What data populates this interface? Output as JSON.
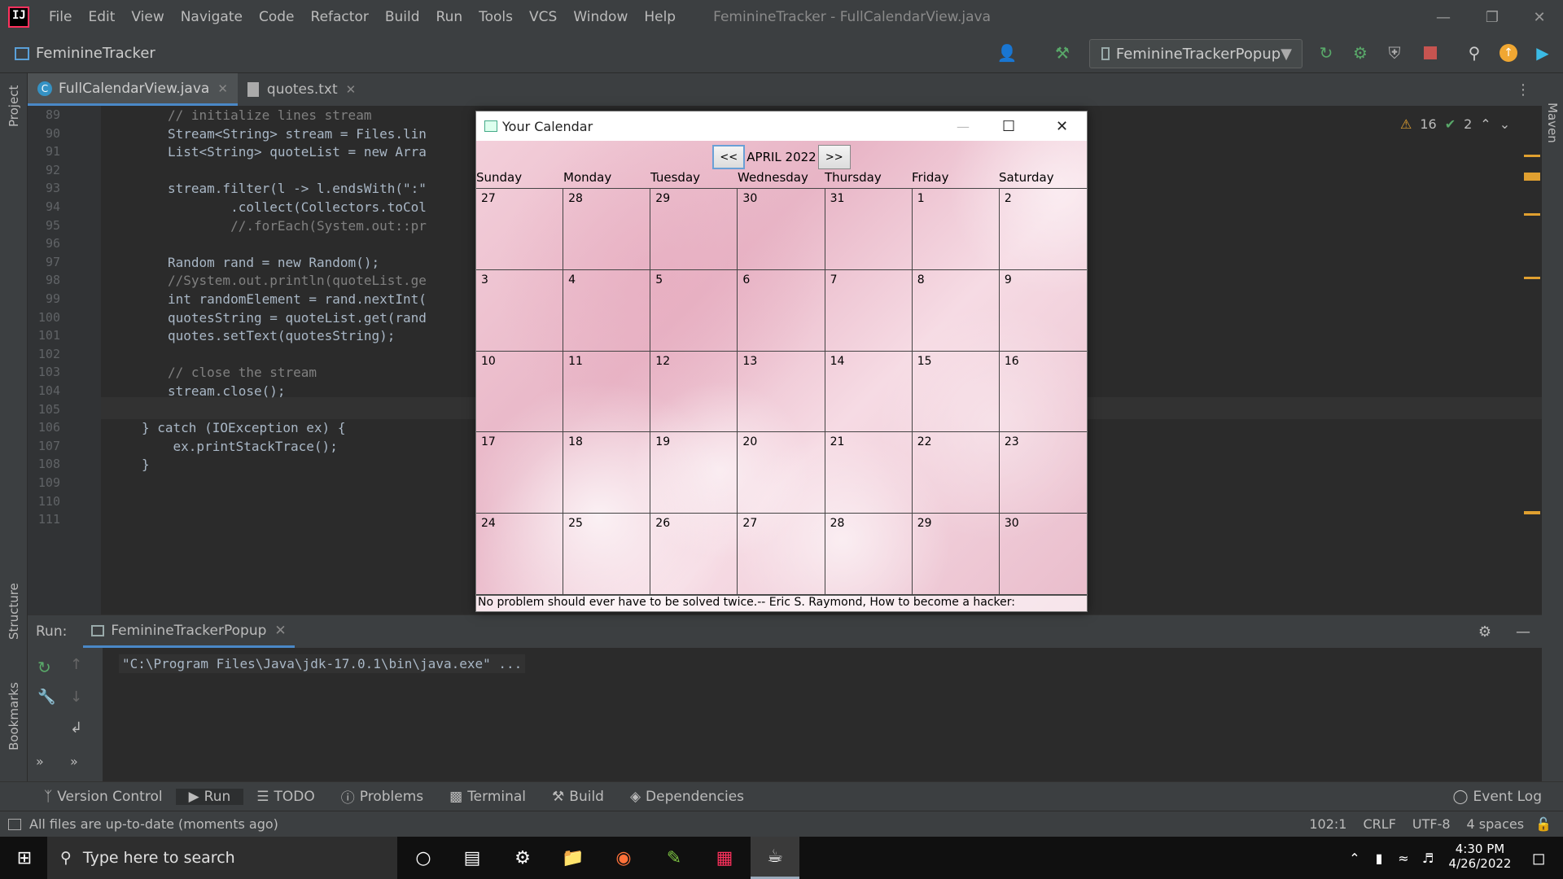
{
  "ide": {
    "menu": [
      "File",
      "Edit",
      "View",
      "Navigate",
      "Code",
      "Refactor",
      "Build",
      "Run",
      "Tools",
      "VCS",
      "Window",
      "Help"
    ],
    "window_title": "FeminineTracker - FullCalendarView.java",
    "project_name": "FeminineTracker",
    "run_config": "FeminineTrackerPopup",
    "left_tools": [
      "Project",
      "Structure",
      "Bookmarks"
    ],
    "right_tools": [
      "Maven"
    ],
    "tabs": [
      {
        "label": "FullCalendarView.java",
        "active": true
      },
      {
        "label": "quotes.txt",
        "active": false
      }
    ],
    "inspections": {
      "warnings": "16",
      "ok": "2"
    },
    "code_lines": [
      {
        "n": "89",
        "text": "// initialize lines stream"
      },
      {
        "n": "90",
        "text": "Stream<String> stream = Files.lin"
      },
      {
        "n": "91",
        "text": "List<String> quoteList = new Arra"
      },
      {
        "n": "92",
        "text": ""
      },
      {
        "n": "93",
        "text": "stream.filter(l -> l.endsWith(\":\""
      },
      {
        "n": "94",
        "text": "        .collect(Collectors.toCol"
      },
      {
        "n": "95",
        "text": "        //.forEach(System.out::pr"
      },
      {
        "n": "96",
        "text": ""
      },
      {
        "n": "97",
        "text": "Random rand = new Random();"
      },
      {
        "n": "98",
        "text": "//System.out.println(quoteList.ge"
      },
      {
        "n": "99",
        "text": "int randomElement = rand.nextInt("
      },
      {
        "n": "100",
        "text": "quotesString = quoteList.get(rand"
      },
      {
        "n": "101",
        "text": "quotes.setText(quotesString);"
      },
      {
        "n": "102",
        "text": ""
      },
      {
        "n": "103",
        "text": "// close the stream"
      },
      {
        "n": "104",
        "text": "stream.close();"
      },
      {
        "n": "105",
        "text": ""
      },
      {
        "n": "106",
        "text": "} catch (IOException ex) {"
      },
      {
        "n": "107",
        "text": "    ex.printStackTrace();"
      },
      {
        "n": "108",
        "text": "}"
      },
      {
        "n": "109",
        "text": ""
      },
      {
        "n": "110",
        "text": ""
      },
      {
        "n": "111",
        "text": ""
      }
    ],
    "line90_tail": "\"));",
    "run_panel": {
      "label": "Run:",
      "tab": "FeminineTrackerPopup",
      "console": "\"C:\\Program Files\\Java\\jdk-17.0.1\\bin\\java.exe\" ..."
    },
    "bottom_tabs": [
      "Version Control",
      "Run",
      "TODO",
      "Problems",
      "Terminal",
      "Build",
      "Dependencies"
    ],
    "event_log": "Event Log",
    "status": {
      "message": "All files are up-to-date (moments ago)",
      "position": "102:1",
      "line_sep": "CRLF",
      "encoding": "UTF-8",
      "indent": "4 spaces"
    }
  },
  "popup": {
    "title": "Your Calendar",
    "prev": "<<",
    "next": ">>",
    "month": "APRIL 2022",
    "days": [
      "Sunday",
      "Monday",
      "Tuesday",
      "Wednesday",
      "Thursday",
      "Friday",
      "Saturday"
    ],
    "dates": [
      "27",
      "28",
      "29",
      "30",
      "31",
      "1",
      "2",
      "3",
      "4",
      "5",
      "6",
      "7",
      "8",
      "9",
      "10",
      "11",
      "12",
      "13",
      "14",
      "15",
      "16",
      "17",
      "18",
      "19",
      "20",
      "21",
      "22",
      "23",
      "24",
      "25",
      "26",
      "27",
      "28",
      "29",
      "30"
    ],
    "quote": "No problem should ever have to be solved twice.-- Eric S. Raymond, How to become a hacker:"
  },
  "taskbar": {
    "search_placeholder": "Type here to search",
    "time": "4:30 PM",
    "date": "4/26/2022"
  }
}
